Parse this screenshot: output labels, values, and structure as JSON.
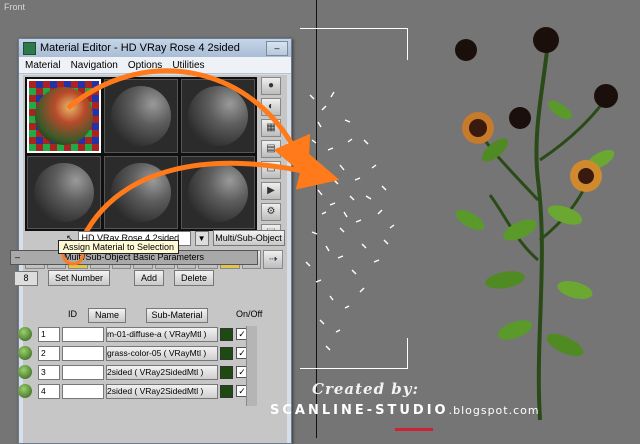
{
  "viewport": {
    "label": "Front"
  },
  "window": {
    "title": "Material Editor - HD VRay Rose 4 2sided",
    "menu": [
      "Material",
      "Navigation",
      "Options",
      "Utilities"
    ]
  },
  "editor": {
    "material_name": "HD VRay Rose 4 2sided",
    "material_type": "Multi/Sub-Object",
    "tooltip": "Assign Material to Selection",
    "rollout_title": "Multi/Sub-Object Basic Parameters",
    "count": "8",
    "buttons": {
      "set_number": "Set Number",
      "add": "Add",
      "delete": "Delete"
    },
    "columns": {
      "id": "ID",
      "name": "Name",
      "sub_material": "Sub-Material",
      "onoff": "On/Off"
    },
    "rows": [
      {
        "id": "1",
        "sub": "m-01-diffuse-a  ( VRayMtl )"
      },
      {
        "id": "2",
        "sub": "grass-color-05  ( VRayMtl )"
      },
      {
        "id": "3",
        "sub": "2sided  ( VRay2SidedMtl )"
      },
      {
        "id": "4",
        "sub": "2sided  ( VRay2SidedMtl )"
      }
    ]
  },
  "credit": {
    "line1": "Created by:",
    "line2": "SCANLINE-STUDIO",
    "line2_suffix": ".blogspot.com"
  },
  "colors": {
    "arrow": "#ff7a1a",
    "viewport_bg": "#757575"
  }
}
